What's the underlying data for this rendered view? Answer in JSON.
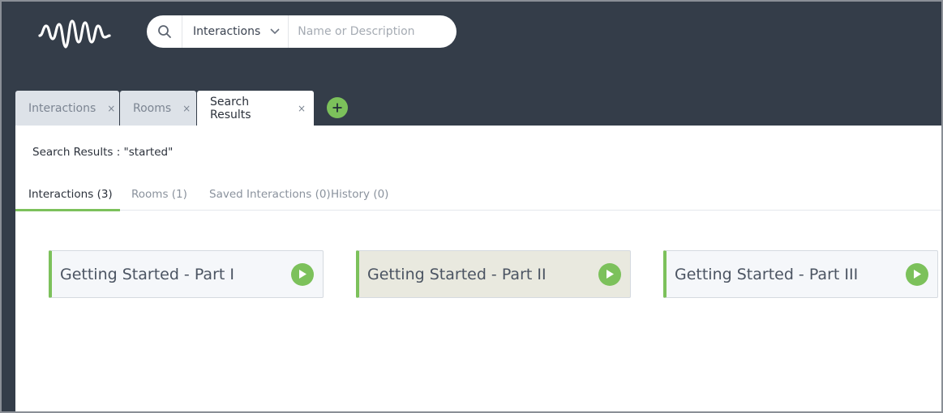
{
  "header": {
    "logo_icon": "waveform-logo-icon",
    "search": {
      "scope_label": "Interactions",
      "placeholder": "Name or Description",
      "value": ""
    }
  },
  "tabs": [
    {
      "label": "Interactions",
      "close": "×"
    },
    {
      "label": "Rooms",
      "close": "×"
    },
    {
      "label": "Search Results",
      "close": "×"
    }
  ],
  "content": {
    "results_title": "Search Results : \"started\"",
    "subtabs": [
      {
        "label": "Interactions (3)"
      },
      {
        "label": "Rooms (1)"
      },
      {
        "label": "Saved Interactions (0)"
      },
      {
        "label": "History (0)"
      }
    ],
    "cards": [
      {
        "title": "Getting Started - Part I"
      },
      {
        "title": "Getting Started - Part II"
      },
      {
        "title": "Getting Started - Part III"
      }
    ]
  },
  "colors": {
    "header_bg": "#343d49",
    "accent_green": "#7cc15b",
    "tab_inactive": "#dde2e8",
    "card_bg": "#f5f7fa",
    "card_highlight_bg": "#e9e9df"
  }
}
